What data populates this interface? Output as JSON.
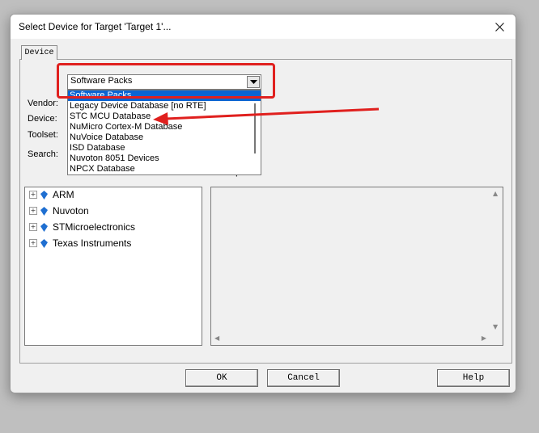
{
  "window": {
    "title": "Select Device for Target 'Target 1'..."
  },
  "tabs": [
    {
      "label": "Device"
    }
  ],
  "form": {
    "vendor_label": "Vendor:",
    "device_label": "Device:",
    "toolset_label": "Toolset:",
    "search_label": "Search:",
    "description_label": "Description:"
  },
  "combo": {
    "selected": "Software Packs",
    "options": [
      "Software Packs",
      "Legacy Device Database [no RTE]",
      "STC MCU Database",
      "NuMicro Cortex-M Database",
      "NuVoice Database",
      "ISD Database",
      "Nuvoton 8051 Devices",
      "NPCX Database"
    ]
  },
  "tree": {
    "items": [
      {
        "label": "ARM",
        "icon": "diamond-icon"
      },
      {
        "label": "Nuvoton",
        "icon": "diamond-icon"
      },
      {
        "label": "STMicroelectronics",
        "icon": "diamond-icon"
      },
      {
        "label": "Texas Instruments",
        "icon": "diamond-icon"
      }
    ]
  },
  "buttons": {
    "ok": "OK",
    "cancel": "Cancel",
    "help": "Help"
  },
  "colors": {
    "selection": "#0a64d2",
    "annotation": "#e0201e",
    "tree_icon": "#1f6fd1"
  }
}
